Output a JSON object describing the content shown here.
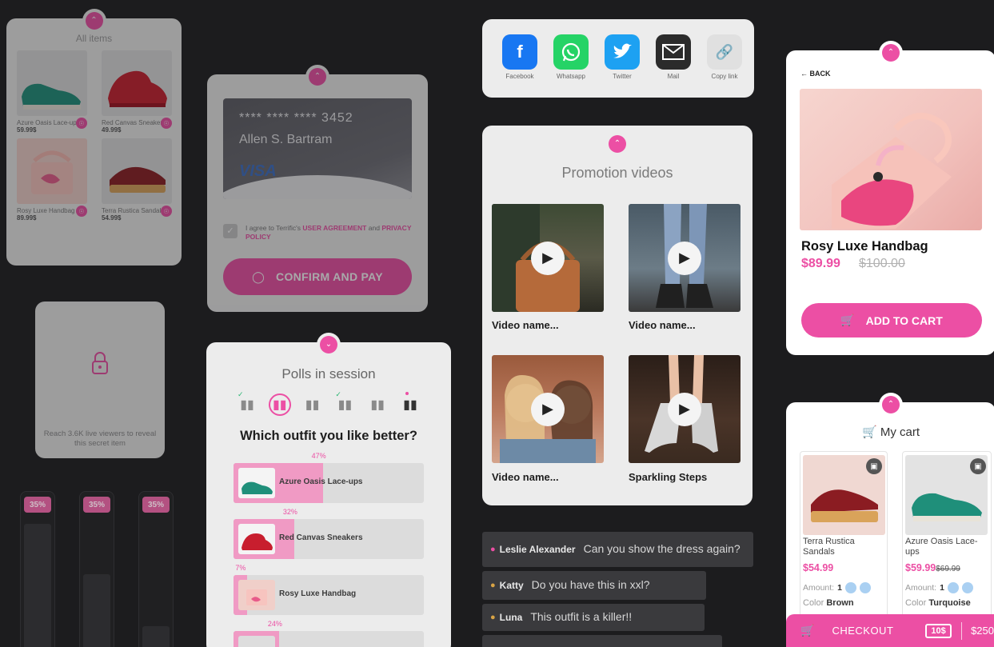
{
  "all_items": {
    "title": "All items",
    "items": [
      {
        "name": "Azure Oasis Lace-ups",
        "price": "59.99$"
      },
      {
        "name": "Red Canvas Sneakers",
        "price": "49.99$"
      },
      {
        "name": "Rosy Luxe Handbag",
        "price": "89.99$"
      },
      {
        "name": "Terra Rustica Sandals",
        "price": "54.99$"
      }
    ]
  },
  "payment": {
    "card_number": "**** **** **** 3452",
    "card_holder": "Allen S. Bartram",
    "card_brand": "VISA",
    "agree_prefix": "I agree to Terrific's",
    "user_agreement": "USER AGREEMENT",
    "agree_and": "and",
    "privacy_policy": "PRIVACY POLICY",
    "confirm_label": "CONFIRM AND PAY"
  },
  "secret_item": {
    "message": "Reach 3.6K live viewers to reveal this secret item"
  },
  "progress_bars": [
    {
      "label": "35%",
      "level": 0.8
    },
    {
      "label": "35%",
      "level": 0.48
    },
    {
      "label": "35%",
      "level": 0.15
    }
  ],
  "polls": {
    "title": "Polls in session",
    "question": "Which outfit you like better?",
    "options": [
      {
        "label": "Azure Oasis Lace-ups",
        "percent": "47%",
        "value": 47
      },
      {
        "label": "Red Canvas Sneakers",
        "percent": "32%",
        "value": 32
      },
      {
        "label": "Rosy Luxe Handbag",
        "percent": "7%",
        "value": 7
      },
      {
        "label": "",
        "percent": "24%",
        "value": 24
      }
    ]
  },
  "share": {
    "items": [
      {
        "label": "Facebook",
        "icon": "facebook-icon",
        "color": "#1877f2"
      },
      {
        "label": "Whatsapp",
        "icon": "whatsapp-icon",
        "color": "#25d366"
      },
      {
        "label": "Twitter",
        "icon": "twitter-icon",
        "color": "#1da1f2"
      },
      {
        "label": "Mail",
        "icon": "mail-icon",
        "color": "#2b2b2b"
      },
      {
        "label": "Copy link",
        "icon": "link-icon",
        "color": "#e0e0e0"
      }
    ]
  },
  "videos": {
    "title": "Promotion videos",
    "items": [
      {
        "name": "Video name..."
      },
      {
        "name": "Video name..."
      },
      {
        "name": "Video name..."
      },
      {
        "name": "Sparkling Steps"
      }
    ]
  },
  "chat": [
    {
      "user": "Leslie Alexander",
      "message": "Can you show the dress again?"
    },
    {
      "user": "Katty",
      "message": "Do you have this in xxl?"
    },
    {
      "user": "Luna",
      "message": "This outfit is a killer!!"
    }
  ],
  "product": {
    "back_label": "BACK",
    "name": "Rosy Luxe Handbag",
    "price": "$89.99",
    "old_price": "$100.00",
    "add_label": "ADD TO CART"
  },
  "cart": {
    "title": "My cart",
    "items": [
      {
        "name": "Terra Rustica Sandals",
        "price": "$54.99",
        "old_price": "",
        "amount_label": "Amount:",
        "amount": "1",
        "color_label": "Color",
        "color": "Brown"
      },
      {
        "name": "Azure Oasis Lace-ups",
        "price": "$59.99",
        "old_price": "$69.99",
        "amount_label": "Amount:",
        "amount": "1",
        "color_label": "Color",
        "color": "Turquoise"
      }
    ],
    "checkout_label": "CHECKOUT",
    "coupon": "10$",
    "total": "$250"
  },
  "colors": {
    "accent": "#ec4fa4",
    "background": "#1c1c1e",
    "card": "#ececec"
  }
}
